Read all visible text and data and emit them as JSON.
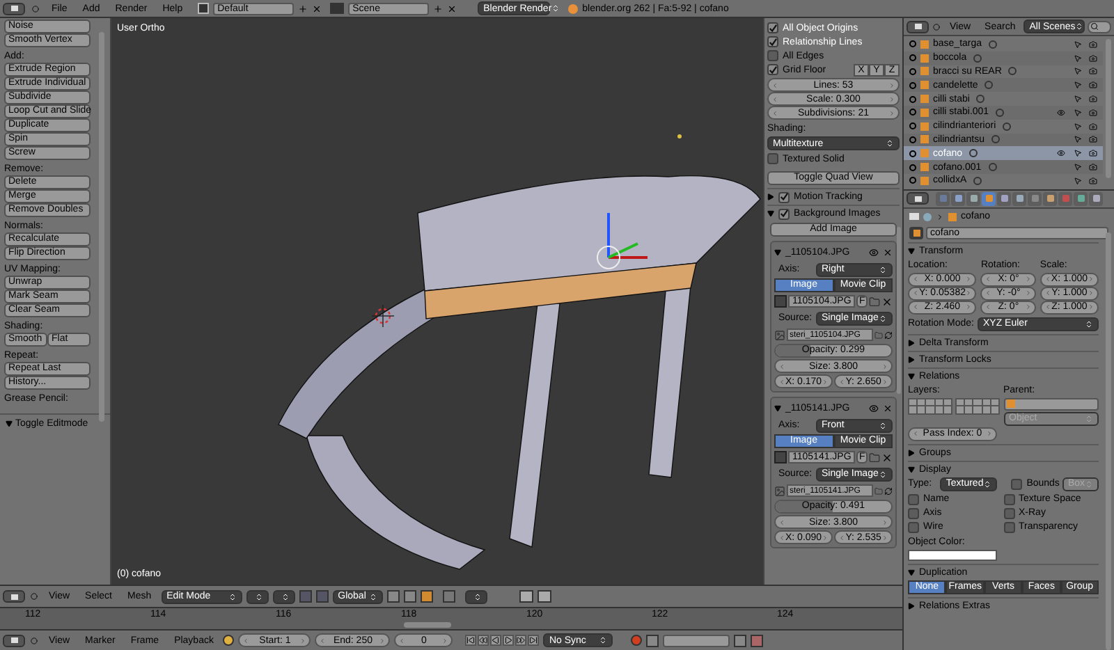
{
  "top_header": {
    "menus": [
      "File",
      "Add",
      "Render",
      "Help"
    ],
    "layout": "Default",
    "scene": "Scene",
    "engine": "Blender Render",
    "info": "blender.org 262 | Fa:5-92 | cofano"
  },
  "toolbar": {
    "sections": [
      {
        "kind": "column",
        "buttons": [
          "Noise",
          "Smooth Vertex"
        ]
      },
      {
        "title": "Add:",
        "kind": "column",
        "buttons": [
          "Extrude Region",
          "Extrude Individual",
          "Subdivide",
          "Loop Cut and Slide",
          "Duplicate",
          "Spin",
          "Screw"
        ]
      },
      {
        "title": "Remove:",
        "kind": "column",
        "buttons": [
          "Delete",
          "Merge",
          "Remove Doubles"
        ]
      },
      {
        "title": "Normals:",
        "kind": "column",
        "buttons": [
          "Recalculate",
          "Flip Direction"
        ]
      },
      {
        "title": "UV Mapping:",
        "kind": "column",
        "buttons": [
          "Unwrap",
          "Mark Seam",
          "Clear Seam"
        ]
      },
      {
        "title": "Shading:",
        "kind": "row",
        "buttons": [
          "Smooth",
          "Flat"
        ]
      },
      {
        "title": "Repeat:",
        "kind": "column",
        "buttons": [
          "Repeat Last",
          "History..."
        ]
      },
      {
        "title": "Grease Pencil:",
        "kind": "column"
      }
    ],
    "footer": "Toggle Editmode"
  },
  "viewport": {
    "view_label": "User Ortho",
    "object_label": "(0) cofano"
  },
  "view_panel": {
    "checks": [
      {
        "label": "All Object Origins",
        "checked": true
      },
      {
        "label": "Relationship Lines",
        "checked": true
      },
      {
        "label": "All Edges",
        "checked": false
      },
      {
        "label": "Grid Floor",
        "checked": true
      }
    ],
    "axes": [
      "X",
      "Y",
      "Z"
    ],
    "fields": [
      "Lines: 53",
      "Scale: 0.300",
      "Subdivisions: 21"
    ],
    "shading_label": "Shading:",
    "shading": "Multitexture",
    "textured_solid": {
      "label": "Textured Solid",
      "checked": false
    },
    "quad_button": "Toggle Quad View",
    "panels": [
      {
        "label": "Motion Tracking",
        "expanded": false,
        "checked": true
      },
      {
        "label": "Background Images",
        "expanded": true,
        "checked": true
      }
    ],
    "add_image": "Add Image",
    "images": [
      {
        "name": "_1105104.JPG",
        "axis_label": "Axis:",
        "axis": "Right",
        "tabs": [
          {
            "label": "Image",
            "selected": true
          },
          {
            "label": "Movie Clip",
            "selected": false
          }
        ],
        "file": "1105104.JPG",
        "file_flag": "F",
        "source_label": "Source:",
        "source": "Single Image",
        "path": "steri_1105104.JPG",
        "opacity": {
          "text": "Opacity: 0.299",
          "level": 0.299
        },
        "size": "Size: 3.800",
        "x": "X: 0.170",
        "y": "Y: 2.650"
      },
      {
        "name": "_1105141.JPG",
        "axis_label": "Axis:",
        "axis": "Front",
        "tabs": [
          {
            "label": "Image",
            "selected": true
          },
          {
            "label": "Movie Clip",
            "selected": false
          }
        ],
        "file": "1105141.JPG",
        "file_flag": "F",
        "source_label": "Source:",
        "source": "Single Image",
        "path": "steri_1105141.JPG",
        "opacity": {
          "text": "Opacity: 0.491",
          "level": 0.491
        },
        "size": "Size: 3.800",
        "x": "X: 0.090",
        "y": "Y: 2.535"
      }
    ]
  },
  "outliner": {
    "menus": [
      "View",
      "Search"
    ],
    "scope": "All Scenes",
    "items": [
      {
        "name": "base_targa",
        "selected": false,
        "visible": false
      },
      {
        "name": "boccola",
        "selected": false,
        "visible": false
      },
      {
        "name": "bracci su REAR",
        "selected": false,
        "visible": false
      },
      {
        "name": "candelette",
        "selected": false,
        "visible": false
      },
      {
        "name": "cilli stabi",
        "selected": false,
        "visible": false
      },
      {
        "name": "cilli stabi.001",
        "selected": false,
        "visible": true
      },
      {
        "name": "cilindrianteriori",
        "selected": false,
        "visible": false
      },
      {
        "name": "cilindriantsu",
        "selected": false,
        "visible": false
      },
      {
        "name": "cofano",
        "selected": true,
        "visible": true
      },
      {
        "name": "cofano.001",
        "selected": false,
        "visible": false
      },
      {
        "name": "collidxA",
        "selected": false,
        "visible": false
      }
    ]
  },
  "properties": {
    "tabs": [
      {
        "selected": false
      },
      {
        "selected": false
      },
      {
        "selected": false
      },
      {
        "selected": true
      },
      {
        "selected": false
      },
      {
        "selected": false
      },
      {
        "selected": false
      },
      {
        "selected": false
      },
      {
        "selected": false
      },
      {
        "selected": false
      },
      {
        "selected": false
      }
    ],
    "breadcrumb": "cofano",
    "name": "cofano",
    "sections": [
      {
        "kind": "transform",
        "title": "Transform",
        "expanded": true,
        "columns": [
          {
            "label": "Location:",
            "values": [
              "X: 0.000",
              "Y: 0.05382",
              "Z: 2.460"
            ]
          },
          {
            "label": "Rotation:",
            "values": [
              "X: 0°",
              "Y: -0°",
              "Z: 0°"
            ]
          },
          {
            "label": "Scale:",
            "values": [
              "X: 1.000",
              "Y: 1.000",
              "Z: 1.000"
            ]
          }
        ],
        "mode_label": "Rotation Mode:",
        "mode": "XYZ Euler"
      },
      {
        "kind": "plain",
        "title": "Delta Transform",
        "expanded": false
      },
      {
        "kind": "plain",
        "title": "Transform Locks",
        "expanded": false
      },
      {
        "kind": "relations",
        "title": "Relations",
        "expanded": true,
        "layers_label": "Layers:",
        "parent_label": "Parent:",
        "parent_type": "Object",
        "pass_index": "Pass Index: 0"
      },
      {
        "kind": "plain",
        "title": "Groups",
        "expanded": false
      },
      {
        "kind": "display",
        "title": "Display",
        "expanded": true,
        "type_label": "Type:",
        "type": "Textured",
        "bounds": {
          "label": "Bounds",
          "checked": false,
          "shape": "Box"
        },
        "checks": [
          {
            "label": "Name",
            "checked": false
          },
          {
            "label": "Texture Space",
            "checked": false
          },
          {
            "label": "Axis",
            "checked": false
          },
          {
            "label": "X-Ray",
            "checked": false
          },
          {
            "label": "Wire",
            "checked": false
          },
          {
            "label": "Transparency",
            "checked": false
          }
        ],
        "color_label": "Object Color:"
      },
      {
        "kind": "duplication",
        "title": "Duplication",
        "expanded": true,
        "options": [
          {
            "label": "None",
            "selected": true
          },
          {
            "label": "Frames",
            "selected": false
          },
          {
            "label": "Verts",
            "selected": false
          },
          {
            "label": "Faces",
            "selected": false
          },
          {
            "label": "Group",
            "selected": false
          }
        ]
      },
      {
        "kind": "plain",
        "title": "Relations Extras",
        "expanded": false
      }
    ]
  },
  "view3d_header": {
    "menus": [
      "View",
      "Select",
      "Mesh"
    ],
    "mode": "Edit Mode",
    "orientation": "Global"
  },
  "timeline": {
    "ticks": [
      "112",
      "114",
      "116",
      "118",
      "120",
      "122",
      "124"
    ],
    "menus": [
      "View",
      "Marker",
      "Frame",
      "Playback"
    ],
    "start": "Start: 1",
    "end": "End: 250",
    "frame": "0",
    "sync": "No Sync"
  }
}
